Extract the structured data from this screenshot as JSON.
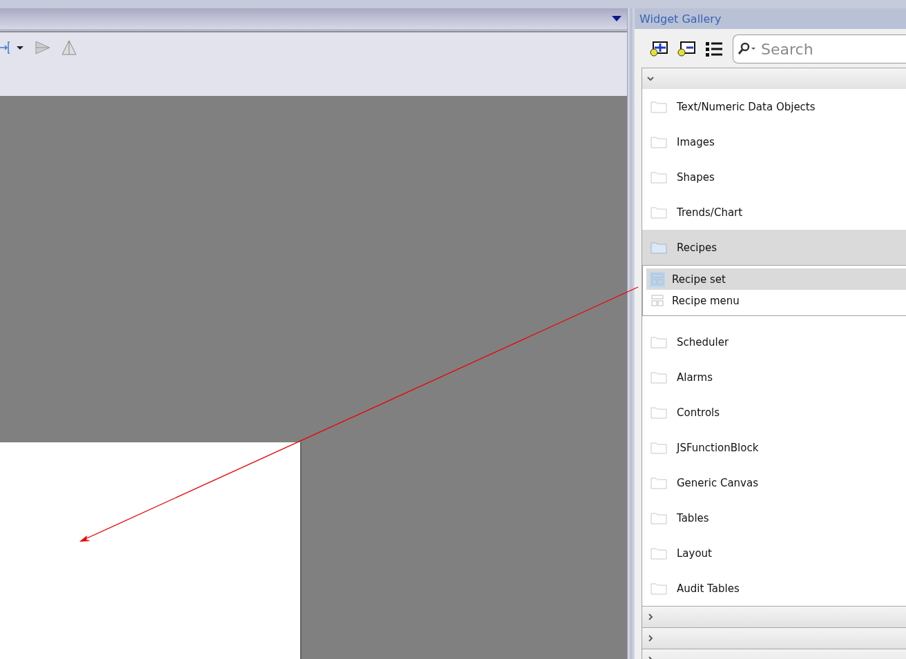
{
  "gallery": {
    "title": "Widget Gallery",
    "search": {
      "placeholder": "Search"
    },
    "sections": [
      {
        "expanded": true,
        "items": [
          {
            "label": "Text/Numeric Data Objects",
            "selected": false,
            "expanded": false
          },
          {
            "label": "Images",
            "selected": false,
            "expanded": false
          },
          {
            "label": "Shapes",
            "selected": false,
            "expanded": false
          },
          {
            "label": "Trends/Chart",
            "selected": false,
            "expanded": false
          },
          {
            "label": "Recipes",
            "selected": true,
            "expanded": true,
            "children": [
              {
                "label": "Recipe set",
                "selected": true
              },
              {
                "label": "Recipe menu",
                "selected": false
              }
            ]
          },
          {
            "label": "Scheduler",
            "selected": false,
            "expanded": false
          },
          {
            "label": "Alarms",
            "selected": false,
            "expanded": false
          },
          {
            "label": "Controls",
            "selected": false,
            "expanded": false
          },
          {
            "label": "JSFunctionBlock",
            "selected": false,
            "expanded": false
          },
          {
            "label": "Generic Canvas",
            "selected": false,
            "expanded": false
          },
          {
            "label": "Tables",
            "selected": false,
            "expanded": false
          },
          {
            "label": "Layout",
            "selected": false,
            "expanded": false
          },
          {
            "label": "Audit Tables",
            "selected": false,
            "expanded": false
          }
        ]
      },
      {
        "expanded": false
      },
      {
        "expanded": false
      },
      {
        "expanded": false
      }
    ]
  }
}
